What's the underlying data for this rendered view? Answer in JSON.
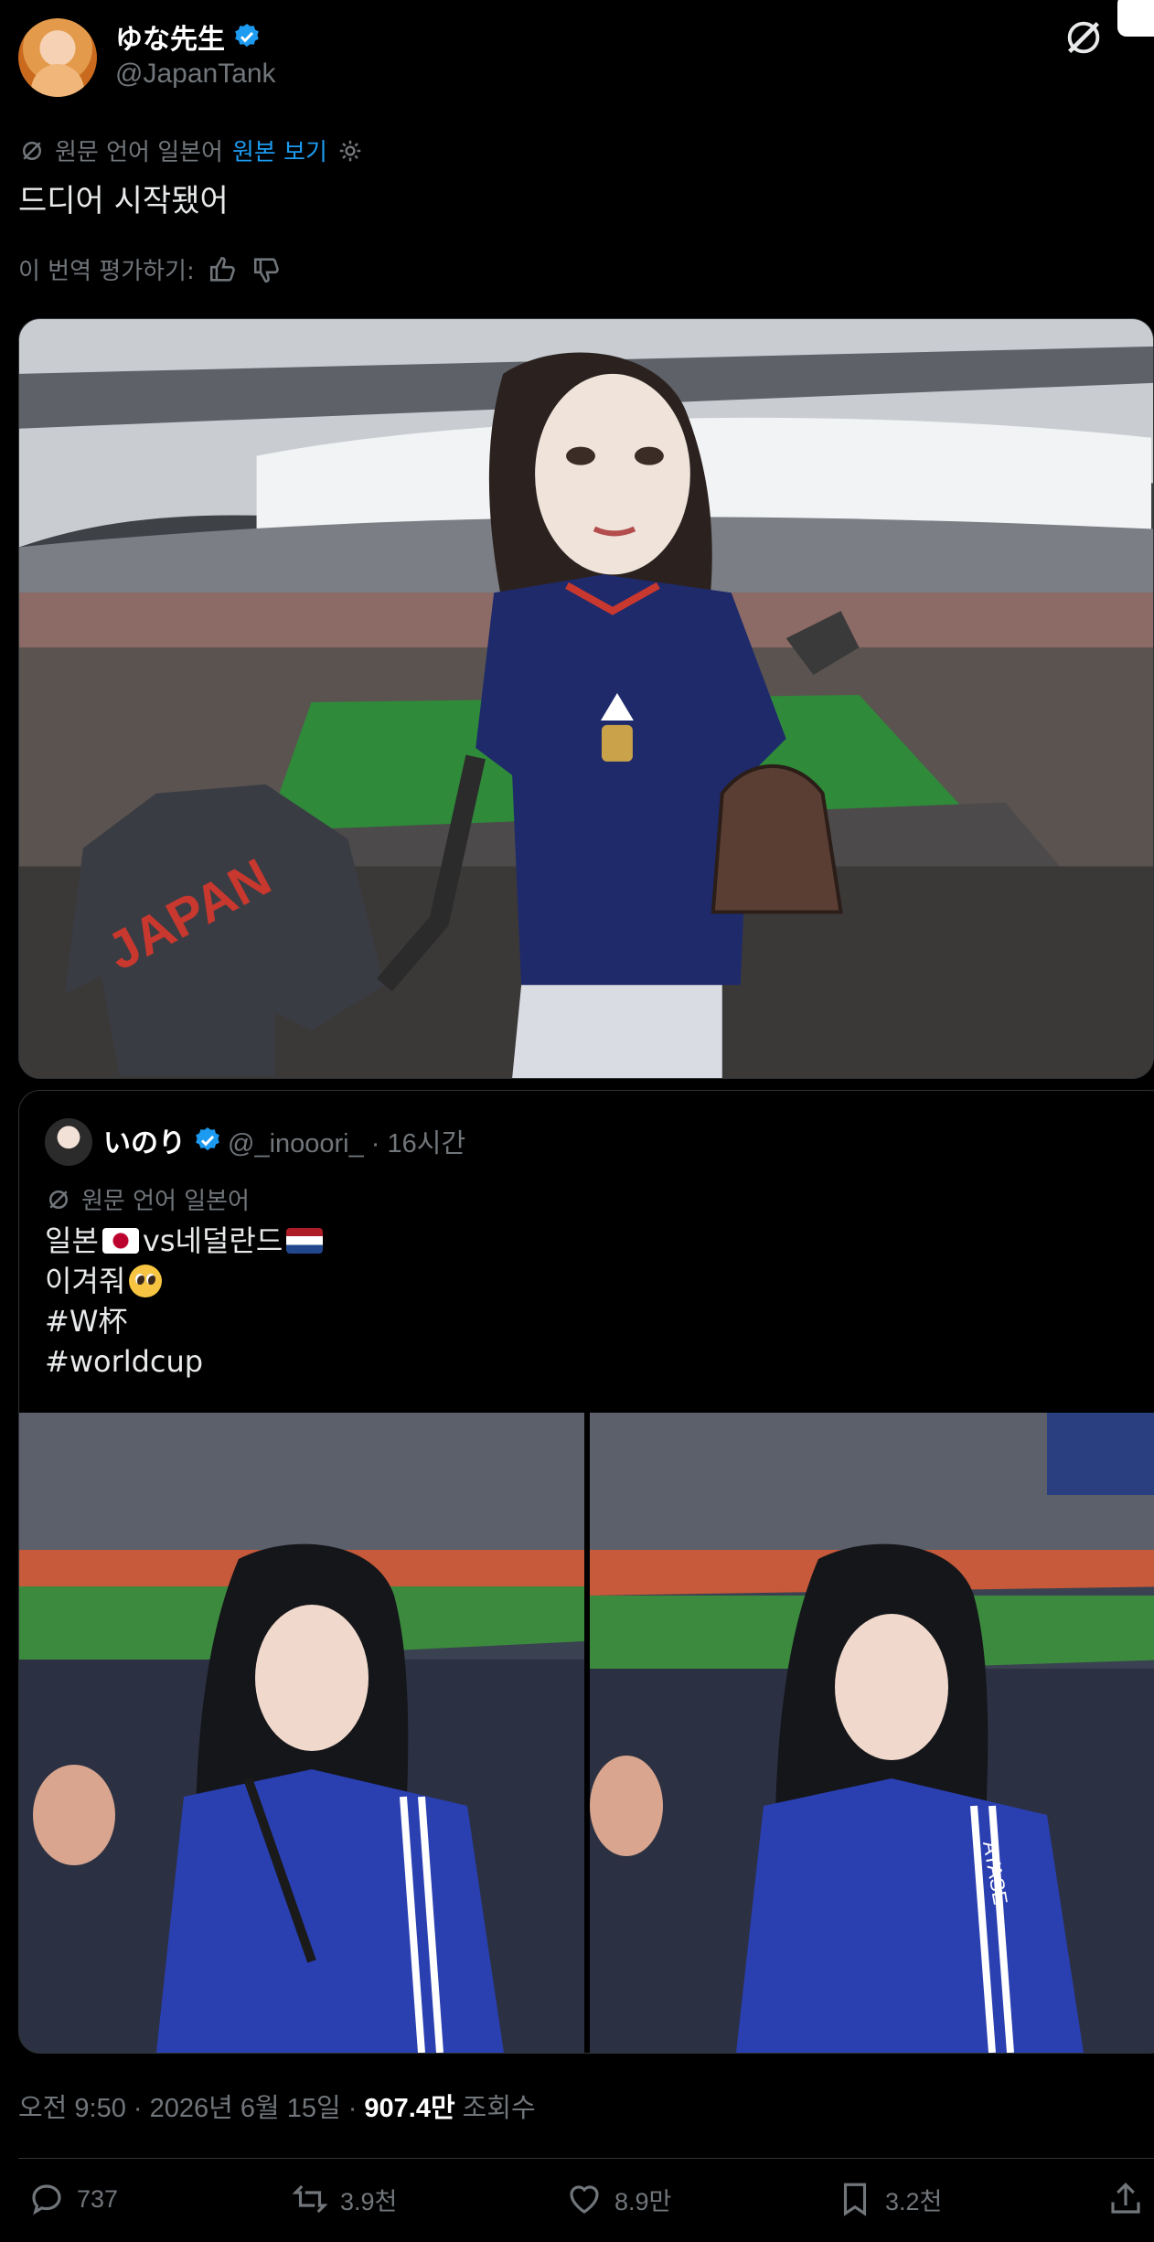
{
  "author": {
    "display_name": "ゆな先生",
    "handle": "@JapanTank",
    "verified": true
  },
  "translation": {
    "source_label": "원문 언어 일본어",
    "view_original_label": "원본 보기"
  },
  "tweet": {
    "text": "드디어 시작됐어",
    "rate_translation_label": "이 번역 평가하기:"
  },
  "quoted": {
    "display_name": "いのり",
    "handle_time": "@_inooori_ · 16시간",
    "translation_label": "원문 언어 일본어",
    "lines": {
      "line1_a": "일본",
      "line1_b": "vs네덜란드",
      "line2": "이겨줘",
      "line3": "#W杯",
      "line4": "#worldcup"
    },
    "photo_labels": {
      "jersey_name": "AYASE"
    }
  },
  "main_media": {
    "jersey_text": "JAPAN"
  },
  "meta": {
    "time_date": "오전 9:50 · 2026년 6월 15일 ·",
    "views_count": "907.4만",
    "views_label": "조회수"
  },
  "actions": {
    "replies": "737",
    "reposts": "3.9천",
    "likes": "8.9만",
    "bookmarks": "3.2천"
  },
  "colors": {
    "accent": "#1d9bf0",
    "muted": "#71767b",
    "text": "#e7e9ea",
    "border": "#2f3336"
  }
}
